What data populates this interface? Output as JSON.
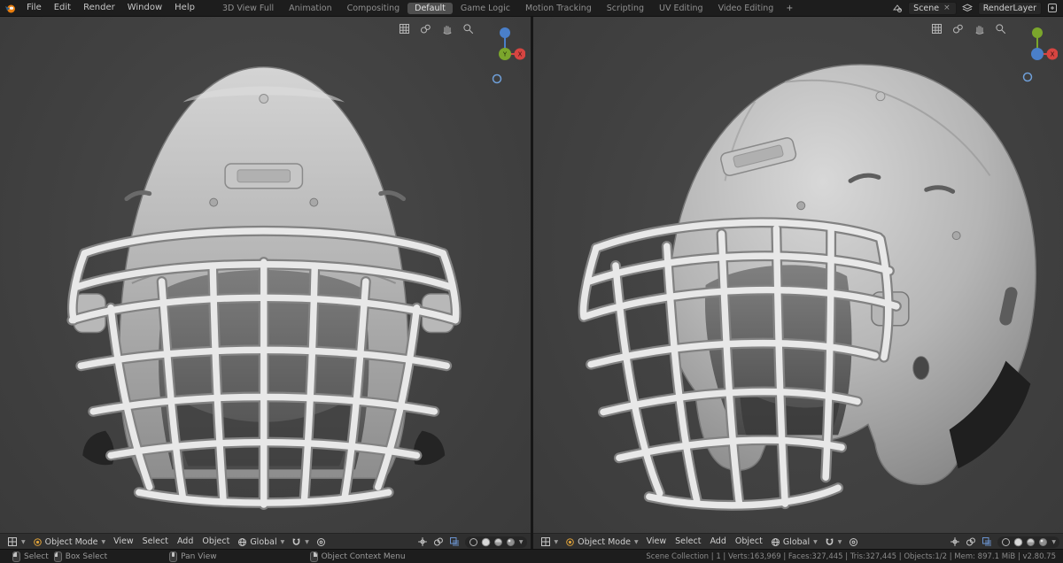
{
  "topbar": {
    "menus": [
      "File",
      "Edit",
      "Render",
      "Window",
      "Help"
    ],
    "tabs": [
      "3D View Full",
      "Animation",
      "Compositing",
      "Default",
      "Game Logic",
      "Motion Tracking",
      "Scripting",
      "UV Editing",
      "Video Editing"
    ],
    "active_tab_index": 3,
    "add_tab": "+",
    "scene": {
      "label": "Scene",
      "close": "×"
    },
    "render_layer": {
      "label": "RenderLayer"
    }
  },
  "viewport_header": {
    "mode": "Object Mode",
    "menus": [
      "View",
      "Select",
      "Add",
      "Object"
    ],
    "orientation": "Global"
  },
  "gizmo": {
    "x": "X",
    "y": "Y"
  },
  "statusbar": {
    "items": [
      "Select",
      "Box Select",
      "Pan View",
      "Object Context Menu"
    ],
    "stats": "Scene Collection | 1 | Verts:163,969 | Faces:327,445 | Tris:327,445 | Objects:1/2 | Mem: 897.1 MiB | v2.80.75"
  },
  "colors": {
    "axis_x": "#d64541",
    "axis_y": "#7ba62c",
    "axis_z": "#4a7fc9",
    "accent": "#5680c2"
  }
}
